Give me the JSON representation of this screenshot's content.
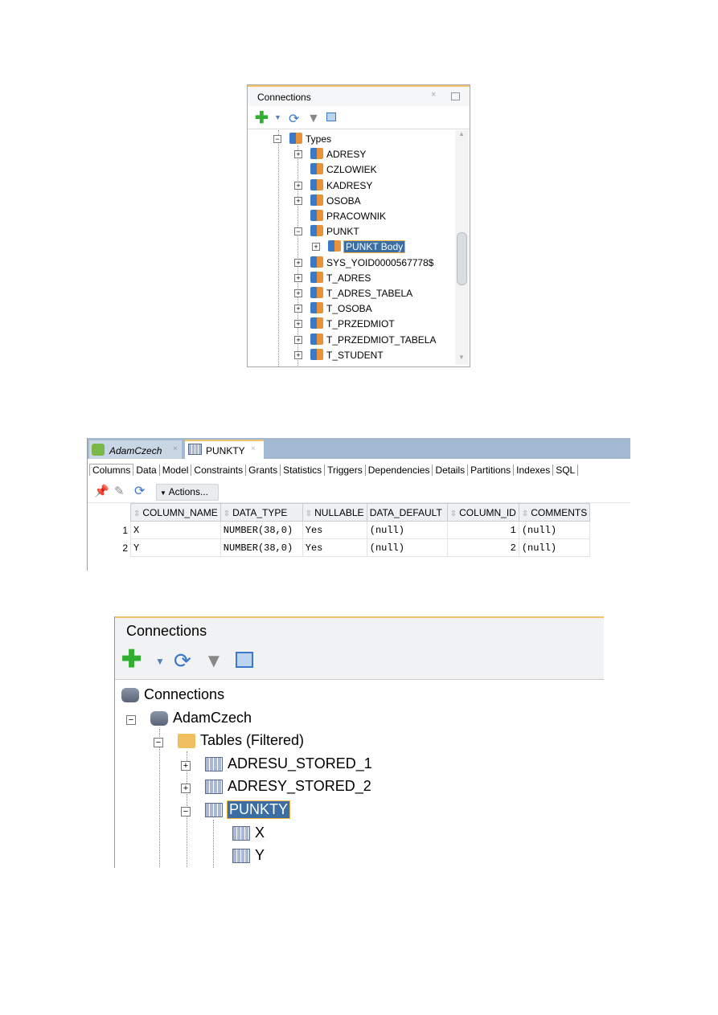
{
  "panel1": {
    "title": "Connections",
    "tree": [
      {
        "label": "Types",
        "level": 0,
        "toggle": "minus"
      },
      {
        "label": "ADRESY",
        "level": 1,
        "toggle": "plus"
      },
      {
        "label": "CZLOWIEK",
        "level": 1,
        "toggle": "none"
      },
      {
        "label": "KADRESY",
        "level": 1,
        "toggle": "plus"
      },
      {
        "label": "OSOBA",
        "level": 1,
        "toggle": "plus"
      },
      {
        "label": "PRACOWNIK",
        "level": 1,
        "toggle": "none"
      },
      {
        "label": "PUNKT",
        "level": 1,
        "toggle": "minus"
      },
      {
        "label": "PUNKT Body",
        "level": 2,
        "toggle": "plus",
        "selected": true
      },
      {
        "label": "SYS_YOID0000567778$",
        "level": 1,
        "toggle": "plus"
      },
      {
        "label": "T_ADRES",
        "level": 1,
        "toggle": "plus"
      },
      {
        "label": "T_ADRES_TABELA",
        "level": 1,
        "toggle": "plus"
      },
      {
        "label": "T_OSOBA",
        "level": 1,
        "toggle": "plus"
      },
      {
        "label": "T_PRZEDMIOT",
        "level": 1,
        "toggle": "plus"
      },
      {
        "label": "T_PRZEDMIOT_TABELA",
        "level": 1,
        "toggle": "plus"
      },
      {
        "label": "T_STUDENT",
        "level": 1,
        "toggle": "plus"
      }
    ]
  },
  "panel2": {
    "tabs": [
      "AdamCzech",
      "PUNKTY"
    ],
    "subtabs": [
      "Columns",
      "Data",
      "Model",
      "Constraints",
      "Grants",
      "Statistics",
      "Triggers",
      "Dependencies",
      "Details",
      "Partitions",
      "Indexes",
      "SQL"
    ],
    "actions_label": "Actions...",
    "columns": [
      "COLUMN_NAME",
      "DATA_TYPE",
      "NULLABLE",
      "DATA_DEFAULT",
      "COLUMN_ID",
      "COMMENTS"
    ],
    "rows": [
      [
        "1",
        "X",
        "NUMBER(38,0)",
        "Yes",
        "(null)",
        "1",
        "(null)"
      ],
      [
        "2",
        "Y",
        "NUMBER(38,0)",
        "Yes",
        "(null)",
        "2",
        "(null)"
      ]
    ]
  },
  "panel3": {
    "title": "Connections",
    "tree": [
      {
        "label": "Connections",
        "level": 0,
        "icon": "connections",
        "toggle": "none"
      },
      {
        "label": "AdamCzech",
        "level": 1,
        "icon": "database",
        "toggle": "minus"
      },
      {
        "label": "Tables (Filtered)",
        "level": 2,
        "icon": "folder",
        "toggle": "minus"
      },
      {
        "label": "ADRESU_STORED_1",
        "level": 3,
        "icon": "table",
        "toggle": "plus"
      },
      {
        "label": "ADRESY_STORED_2",
        "level": 3,
        "icon": "table",
        "toggle": "plus"
      },
      {
        "label": "PUNKTY",
        "level": 3,
        "icon": "table",
        "toggle": "minus",
        "selected": true
      },
      {
        "label": "X",
        "level": 4,
        "icon": "column",
        "toggle": "none"
      },
      {
        "label": "Y",
        "level": 4,
        "icon": "column",
        "toggle": "none"
      }
    ]
  }
}
